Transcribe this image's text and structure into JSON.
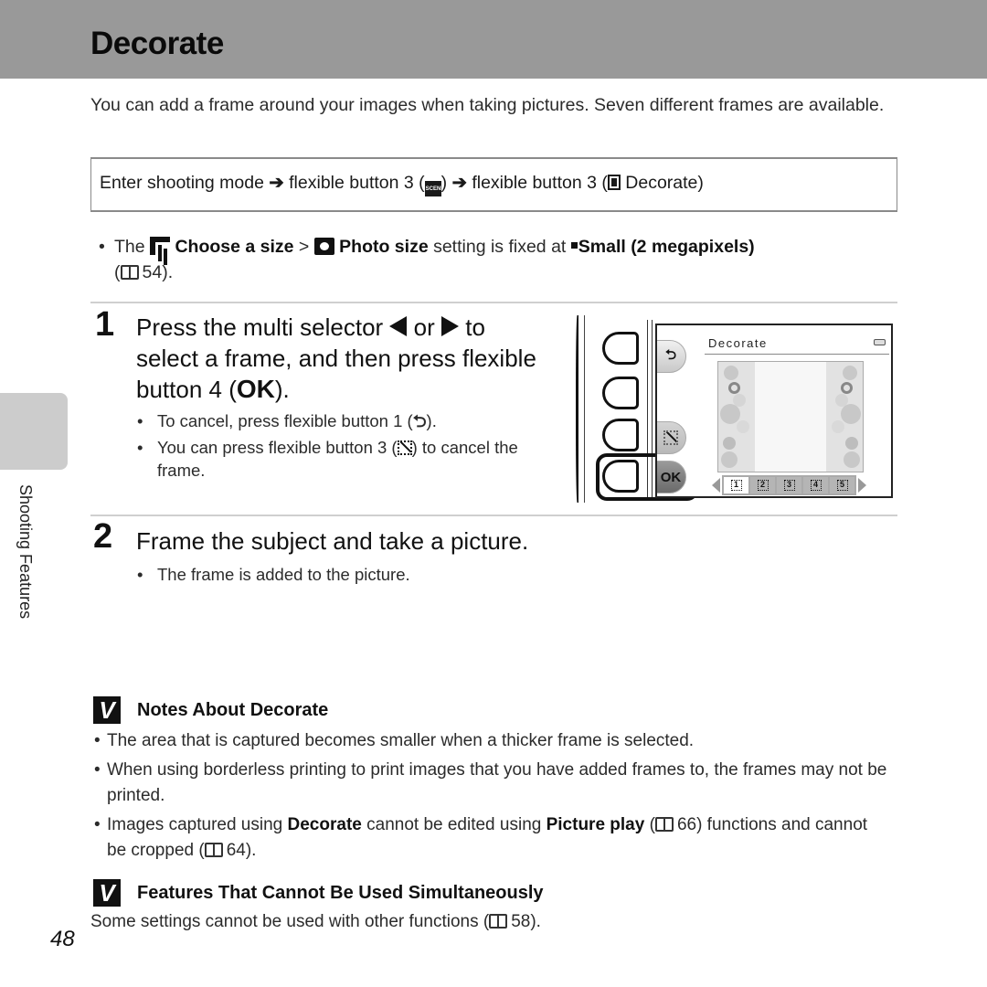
{
  "header": {
    "title": "Decorate",
    "band_color": "#999999"
  },
  "intro": "You can add a frame around your images when taking pictures. Seven different frames are available.",
  "path": {
    "part1": "Enter shooting mode ",
    "arrow": "➔",
    "part2": " flexible button 3 (",
    "scene_icon": "SCENE",
    "part3": ") ",
    "part4": " flexible button 3 (",
    "part5": " Decorate)"
  },
  "size_note": {
    "bullet": "•",
    "pre": "The ",
    "choose_size": "Choose a size",
    "gt": " > ",
    "photo_size": "Photo size",
    "mid": " setting is fixed at ",
    "small": "Small (2 megapixels)",
    "ref_open": "(",
    "ref_page": "54",
    "ref_close": ")."
  },
  "step1": {
    "number": "1",
    "line1_pre": "Press the multi selector ",
    "line1_or": " or ",
    "line1_post": " to",
    "line2": "select a frame, and then press flexible",
    "line3_pre": "button 4 (",
    "ok": "OK",
    "line3_post": ").",
    "bullets": [
      {
        "pre": "To cancel, press flexible button 1 (",
        "glyph": "⮌",
        "post": ")."
      },
      {
        "pre": "You can press flexible button 3 (",
        "post": ") to cancel the frame."
      }
    ]
  },
  "camera_screen": {
    "title": "Decorate",
    "back_label": "⮌",
    "ok_label": "OK",
    "selected_frame": 1,
    "frame_thumbs": [
      "1",
      "2",
      "3",
      "4",
      "5"
    ]
  },
  "step2": {
    "number": "2",
    "title": "Frame the subject and take a picture.",
    "bullets": [
      "The frame is added to the picture."
    ]
  },
  "side_tab": {
    "label": "Shooting Features"
  },
  "notes": {
    "check": "V",
    "heading": "Notes About Decorate",
    "items": [
      {
        "text": "The area that is captured becomes smaller when a thicker frame is selected."
      },
      {
        "text": "When using borderless printing to print images that you have added frames to, the frames may not be printed."
      }
    ],
    "item3": {
      "pre": "Images captured using ",
      "decorate": "Decorate",
      "mid": " cannot be edited using ",
      "picture_play": "Picture play",
      "ref1_open": " (",
      "ref1_page": "66",
      "mid2": ") functions and cannot be cropped (",
      "ref2_page": "64",
      "end": ")."
    }
  },
  "simultaneous": {
    "check": "V",
    "heading": "Features That Cannot Be Used Simultaneously",
    "text_pre": "Some settings cannot be used with other functions (",
    "ref_page": "58",
    "text_post": ")."
  },
  "page_number": "48"
}
